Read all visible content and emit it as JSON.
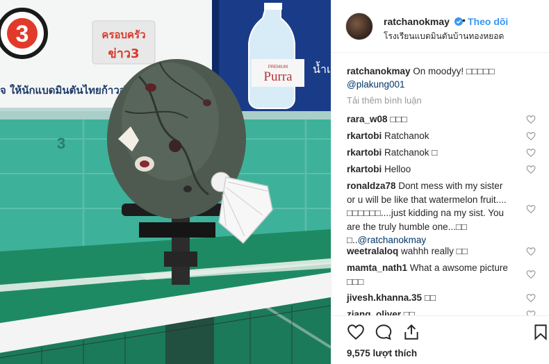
{
  "photo": {
    "sign_channel_number": "3",
    "sign_banner_text": "จ ให้นักแบดมินตันไทยก้าวสู่",
    "sign_news_line1": "ครอบครัว",
    "sign_news_line2": "ข่าว3",
    "bottle_brand_small": "PREMIUM",
    "bottle_brand": "Purra",
    "bottle_partial_text": "น้ำแ",
    "court_number": "3"
  },
  "header": {
    "username": "ratchanokmay",
    "separator": "•",
    "follow_label": "Theo dõi",
    "location": "โรงเรียนแบดมินตันบ้านทองหยอด"
  },
  "caption": {
    "username": "ratchanokmay",
    "text": " On moodyy! ",
    "emoji": "□□□□□",
    "mention": "@plakung001"
  },
  "load_more_label": "Tải thêm bình luận",
  "comments": [
    {
      "user": "rara_w08",
      "text": " □□□"
    },
    {
      "user": "rkartobi",
      "text": " Ratchanok"
    },
    {
      "user": "rkartobi",
      "text": " Ratchanok □"
    },
    {
      "user": "rkartobi",
      "text": " Helloo"
    },
    {
      "user": "ronaldza78",
      "text": " Dont mess with my sister or u will be like that watermelon fruit.... □□□□□□....just kidding na my sist. You are the truly humble one...□□ □..",
      "mention": "@ratchanokmay"
    },
    {
      "user": "weetralaloq",
      "text": " wahhh really □□"
    },
    {
      "user": "mamta_nath1",
      "text": " What a awsome picture □□□"
    },
    {
      "user": "jivesh.khanna.35",
      "text": " □□"
    },
    {
      "user": "ziang_oliver",
      "text": " □□"
    }
  ],
  "likes_label": "9,575 lượt thích",
  "colors": {
    "link": "#3897f0",
    "mention": "#003569",
    "muted": "#999999"
  },
  "icons": [
    "verified-badge-icon",
    "heart-outline-icon",
    "comment-icon",
    "share-icon",
    "bookmark-icon"
  ]
}
